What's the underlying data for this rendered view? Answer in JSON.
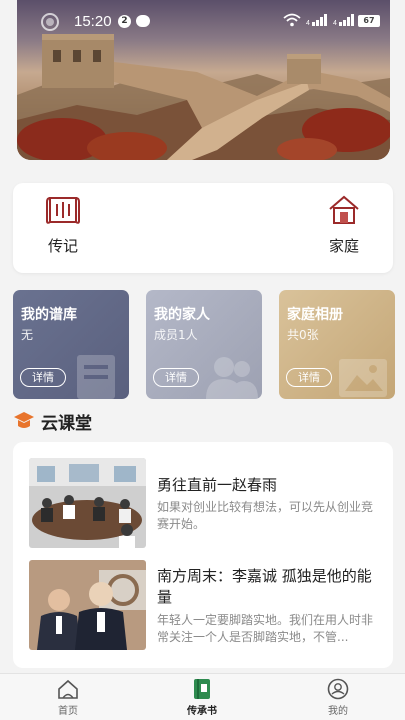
{
  "status_bar": {
    "time": "15:20",
    "notification_count": "2",
    "battery": "67"
  },
  "quick_links": [
    {
      "label": "传记",
      "icon": "scroll-book-icon"
    },
    {
      "label": "家庭",
      "icon": "house-icon"
    }
  ],
  "info_cards": [
    {
      "title": "我的谱库",
      "subtitle": "无",
      "button": "详情",
      "color": "#626985"
    },
    {
      "title": "我的家人",
      "subtitle": "成员1人",
      "button": "详情",
      "color": "#a9adbd"
    },
    {
      "title": "家庭相册",
      "subtitle": "共0张",
      "button": "详情",
      "color": "#cfb586"
    }
  ],
  "section": {
    "title": "云课堂"
  },
  "courses": [
    {
      "title": "勇往直前一赵春雨",
      "description": "如果对创业比较有想法，可以先从创业竞赛开始。"
    },
    {
      "title": "南方周末：李嘉诚 孤独是他的能量",
      "description": "年轻人一定要脚踏实地。我们在用人时非常关注一个人是否脚踏实地，不管..."
    }
  ],
  "tabs": [
    {
      "label": "首页",
      "icon": "home-icon"
    },
    {
      "label": "传承书",
      "icon": "book-icon",
      "active": true
    },
    {
      "label": "我的",
      "icon": "profile-icon"
    }
  ],
  "colors": {
    "accent_red": "#9b2a2a",
    "tab_active": "#2e8b4f",
    "section_icon": "#e8742c"
  }
}
